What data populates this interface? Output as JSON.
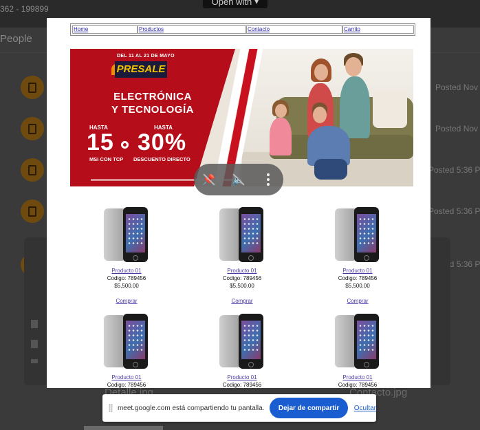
{
  "background_app": {
    "id_fragment": "362 - 199899",
    "open_with_label": "Open with",
    "open_with_caret": "▾",
    "people_label": "People",
    "posted_labels": [
      "Posted Nov",
      "Posted Nov",
      "Posted 5:36 P",
      "Posted 5:36 P",
      "Posted 5:36 P"
    ],
    "file_left": "Detalle.jpg",
    "file_right": "Contacto.jpg"
  },
  "shared_page": {
    "nav": [
      "Home",
      "Productos",
      "Contacto",
      "Carrito"
    ],
    "banner": {
      "date_text": "DEL 11 AL 21 DE MAYO",
      "badge_text": "PRESALE",
      "title_line1": "ELECTRÓNICA",
      "title_line2": "Y TECNOLOGÍA",
      "hasta_left": "HASTA",
      "hasta_right": "HASTA",
      "num_left": "15",
      "num_right": "30%",
      "caption_left": "MSI CON TCP",
      "caption_right": "DESCUENTO DIRECTO"
    },
    "products": [
      {
        "name": "Producto 01",
        "code": "Codigo: 789456",
        "price": "$5,500.00",
        "buy": "Comprar"
      },
      {
        "name": "Producto 01",
        "code": "Codigo: 789456",
        "price": "$5,500.00",
        "buy": "Comprar"
      },
      {
        "name": "Producto 01",
        "code": "Codigo: 789456",
        "price": "$5,500.00",
        "buy": "Comprar"
      },
      {
        "name": "Producto 01",
        "code": "Codigo: 789456",
        "price": "",
        "buy": ""
      },
      {
        "name": "Producto 01",
        "code": "Codigo: 789456",
        "price": "",
        "buy": ""
      },
      {
        "name": "Producto 01",
        "code": "Codigo: 789456",
        "price": "",
        "buy": ""
      }
    ]
  },
  "meet_controls": {
    "icons": [
      "pin-off-icon",
      "volume-off-icon",
      "more-options-icon"
    ]
  },
  "share_bar": {
    "message": "meet.google.com está compartiendo tu pantalla.",
    "stop_label": "Dejar de compartir",
    "hide_label": "Ocultar"
  },
  "colors": {
    "share_button": "#1a5dd0",
    "banner_red": "#b50d1a",
    "link": "#4a3aa8"
  }
}
